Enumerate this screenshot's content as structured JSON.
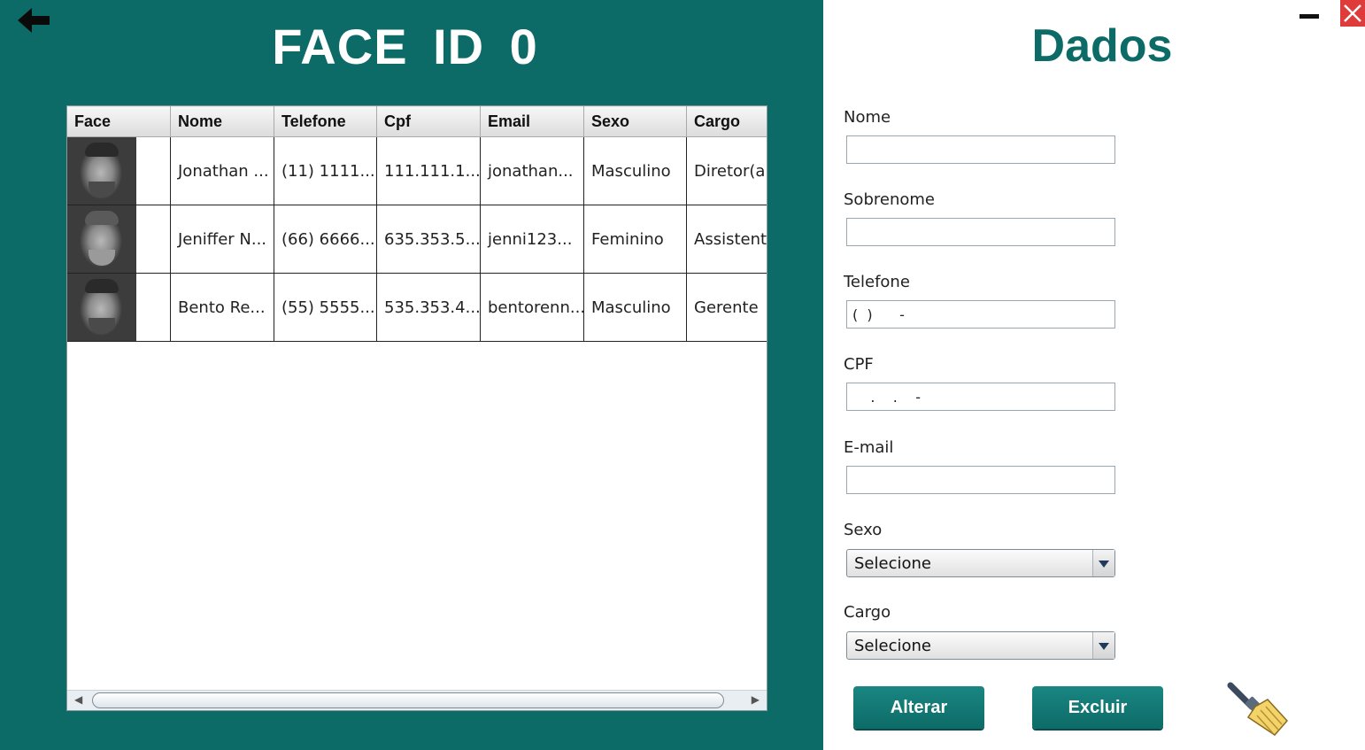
{
  "header": {
    "title": "FACE ID  0"
  },
  "table": {
    "columns": [
      "Face",
      "Nome",
      "Telefone",
      "Cpf",
      "Email",
      "Sexo",
      "Cargo"
    ],
    "rows": [
      {
        "nome": "Jonathan ...",
        "telefone": "(11) 1111...",
        "cpf": "111.111.1...",
        "email": "jonathan...",
        "sexo": "Masculino",
        "cargo": "Diretor(a)"
      },
      {
        "nome": "Jeniffer N...",
        "telefone": "(66) 6666...",
        "cpf": "635.353.5...",
        "email": "jenni123...",
        "sexo": "Feminino",
        "cargo": "Assistente"
      },
      {
        "nome": "Bento Re...",
        "telefone": "(55) 5555...",
        "cpf": "535.353.4...",
        "email": "bentorenn...",
        "sexo": "Masculino",
        "cargo": "Gerente"
      }
    ]
  },
  "form": {
    "title": "Dados",
    "labels": {
      "nome": "Nome",
      "sobrenome": "Sobrenome",
      "telefone": "Telefone",
      "cpf": "CPF",
      "email": "E-mail",
      "sexo": "Sexo",
      "cargo": "Cargo"
    },
    "values": {
      "nome": "",
      "sobrenome": "",
      "telefone": "(  )      -",
      "cpf": "    .    .    -",
      "email": ""
    },
    "sexo_selected": "Selecione",
    "cargo_selected": "Selecione",
    "buttons": {
      "alterar": "Alterar",
      "excluir": "Excluir"
    }
  },
  "icons": {
    "back": "back-arrow-icon",
    "minimize": "minimize-icon",
    "close": "close-icon",
    "clear": "broom-icon"
  },
  "colors": {
    "primary": "#0d6b67",
    "close": "#e03b3b",
    "background": "#ffffff"
  }
}
